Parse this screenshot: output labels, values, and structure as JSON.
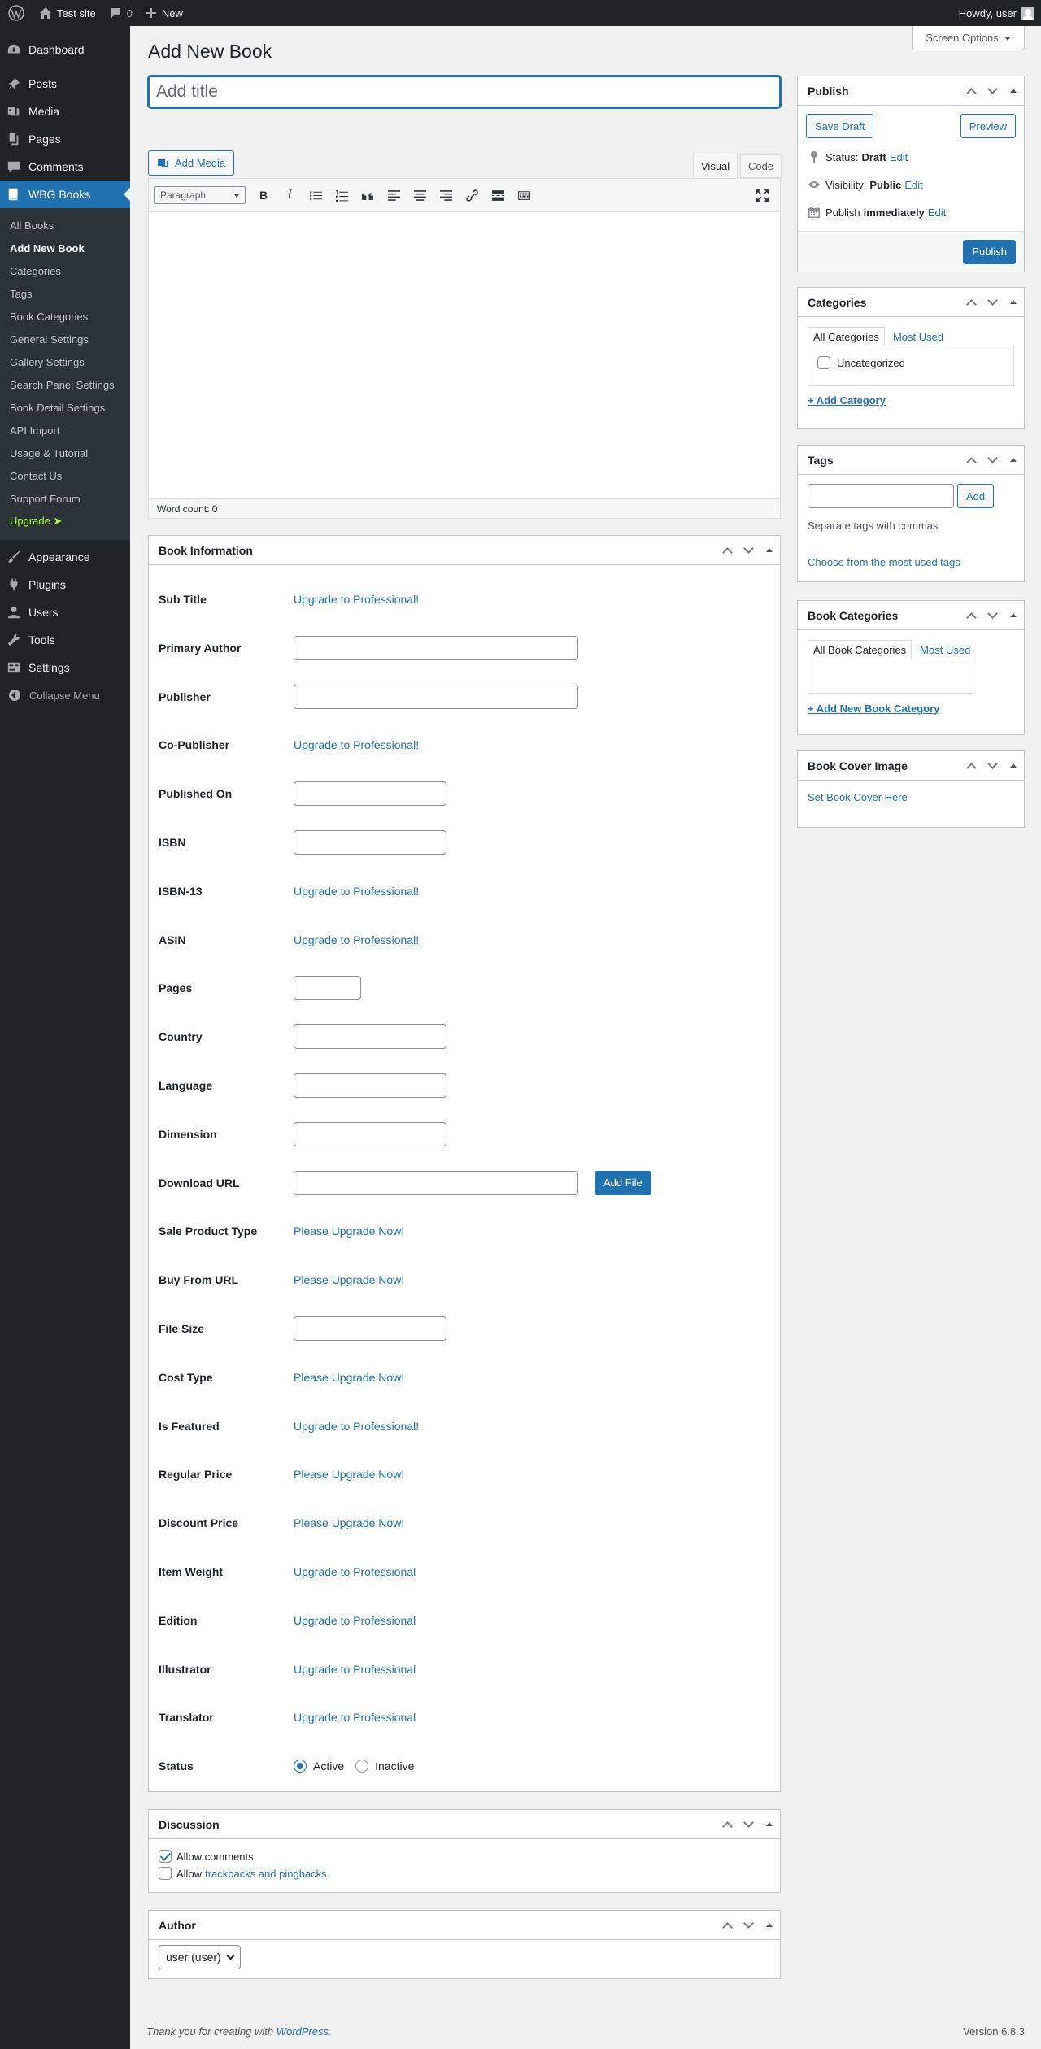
{
  "adminbar": {
    "site_name": "Test site",
    "comments_count": "0",
    "new_label": "New",
    "howdy": "Howdy, user"
  },
  "sidebar": {
    "items_top": [
      {
        "label": "Dashboard",
        "icon": "dashboard-icon"
      },
      {
        "label": "Posts",
        "icon": "pin-icon"
      },
      {
        "label": "Media",
        "icon": "media-icon"
      },
      {
        "label": "Pages",
        "icon": "page-icon"
      },
      {
        "label": "Comments",
        "icon": "comment-icon"
      },
      {
        "label": "WBG Books",
        "icon": "book-icon"
      }
    ],
    "submenu": [
      "All Books",
      "Add New Book",
      "Categories",
      "Tags",
      "Book Categories",
      "General Settings",
      "Gallery Settings",
      "Search Panel Settings",
      "Book Detail Settings",
      "API Import",
      "Usage & Tutorial",
      "Contact Us",
      "Support Forum",
      "Upgrade ➤"
    ],
    "items_bottom": [
      {
        "label": "Appearance",
        "icon": "brush-icon"
      },
      {
        "label": "Plugins",
        "icon": "plugin-icon"
      },
      {
        "label": "Users",
        "icon": "user-icon"
      },
      {
        "label": "Tools",
        "icon": "wrench-icon"
      },
      {
        "label": "Settings",
        "icon": "sliders-icon"
      }
    ],
    "collapse": "Collapse Menu"
  },
  "page": {
    "title": "Add New Book",
    "screen_options": "Screen Options",
    "title_placeholder": "Add title"
  },
  "editor": {
    "add_media": "Add Media",
    "tab_visual": "Visual",
    "tab_code": "Code",
    "format": "Paragraph",
    "word_count": "Word count: 0"
  },
  "publish": {
    "title": "Publish",
    "save_draft": "Save Draft",
    "preview": "Preview",
    "status_label": "Status:",
    "status_value": "Draft",
    "visibility_label": "Visibility:",
    "visibility_value": "Public",
    "publish_label": "Publish",
    "publish_value": "immediately",
    "edit": "Edit",
    "publish_button": "Publish"
  },
  "categories": {
    "title": "Categories",
    "tab_all": "All Categories",
    "tab_most": "Most Used",
    "items": [
      "Uncategorized"
    ],
    "add": "+ Add Category"
  },
  "tags": {
    "title": "Tags",
    "add_button": "Add",
    "hint": "Separate tags with commas",
    "choose": "Choose from the most used tags"
  },
  "book_categories": {
    "title": "Book Categories",
    "tab_all": "All Book Categories",
    "tab_most": "Most Used",
    "add": "+ Add New Book Category"
  },
  "book_cover": {
    "title": "Book Cover Image",
    "link": "Set Book Cover Here"
  },
  "book_info": {
    "title": "Book Information",
    "rows": [
      {
        "label": "Sub Title",
        "link": "Upgrade to Professional!"
      },
      {
        "label": "Primary Author",
        "input": "wide"
      },
      {
        "label": "Publisher",
        "input": "wide"
      },
      {
        "label": "Co-Publisher",
        "link": "Upgrade to Professional!"
      },
      {
        "label": "Published On",
        "input": "mid"
      },
      {
        "label": "ISBN",
        "input": "mid"
      },
      {
        "label": "ISBN-13",
        "link": "Upgrade to Professional!"
      },
      {
        "label": "ASIN",
        "link": "Upgrade to Professional!"
      },
      {
        "label": "Pages",
        "input": "small"
      },
      {
        "label": "Country",
        "input": "mid"
      },
      {
        "label": "Language",
        "input": "mid"
      },
      {
        "label": "Dimension",
        "input": "mid"
      },
      {
        "label": "Download URL",
        "input": "wide",
        "button": "Add File"
      },
      {
        "label": "Sale Product Type",
        "link": "Please Upgrade Now!"
      },
      {
        "label": "Buy From URL",
        "link": "Please Upgrade Now!"
      },
      {
        "label": "File Size",
        "input": "mid"
      },
      {
        "label": "Cost Type",
        "link": "Please Upgrade Now!"
      },
      {
        "label": "Is Featured",
        "link": "Upgrade to Professional!"
      },
      {
        "label": "Regular Price",
        "link": "Please Upgrade Now!"
      },
      {
        "label": "Discount Price",
        "link": "Please Upgrade Now!"
      },
      {
        "label": "Item Weight",
        "link": "Upgrade to Professional"
      },
      {
        "label": "Edition",
        "link": "Upgrade to Professional"
      },
      {
        "label": "Illustrator",
        "link": "Upgrade to Professional"
      },
      {
        "label": "Translator",
        "link": "Upgrade to Professional"
      },
      {
        "label": "Status",
        "radios": [
          "Active",
          "Inactive"
        ]
      }
    ]
  },
  "discussion": {
    "title": "Discussion",
    "allow_comments": "Allow comments",
    "allow_prefix": "Allow",
    "trackbacks": "trackbacks and pingbacks"
  },
  "author": {
    "title": "Author",
    "selected": "user (user)"
  },
  "footer": {
    "thanks_prefix": "Thank you for creating with",
    "wordpress": "WordPress",
    "thanks_suffix": ".",
    "version": "Version 6.8.3"
  },
  "colors": {
    "accent": "#2271b1",
    "sidebar": "#1d2327",
    "upgrade": "#adff2f"
  }
}
